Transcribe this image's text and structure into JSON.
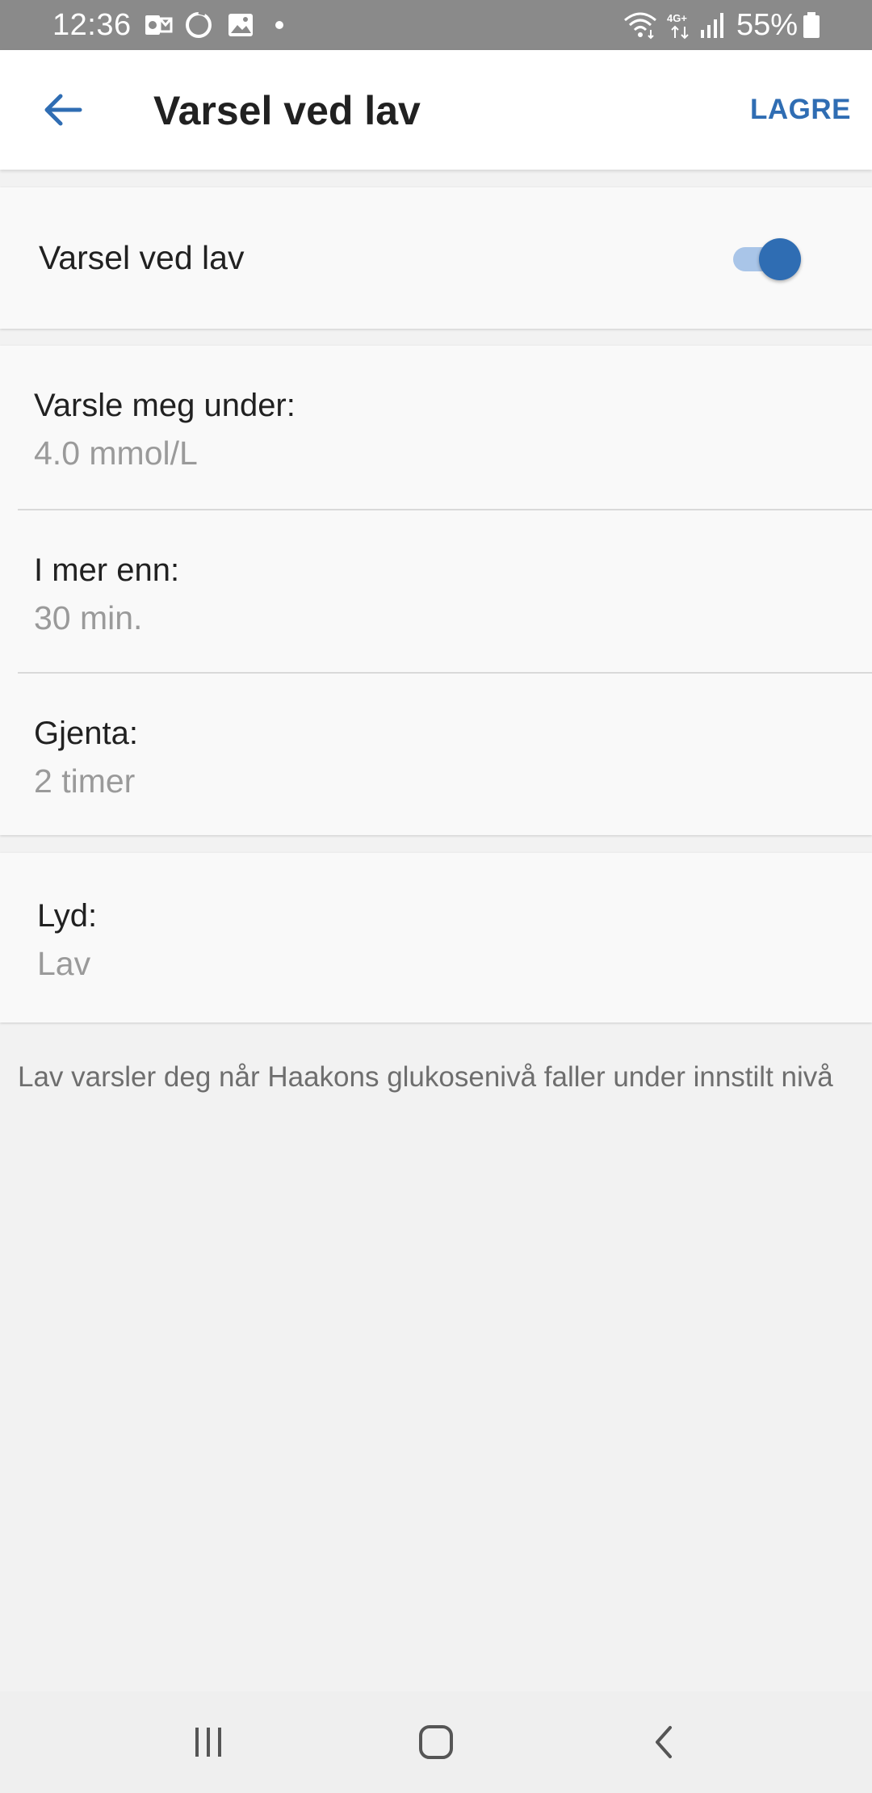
{
  "status_bar": {
    "time": "12:36",
    "battery": "55%",
    "icons": [
      "outlook-icon",
      "sync-circle-icon",
      "gallery-icon",
      "notification-dot-icon",
      "wifi-icon",
      "4g-icon",
      "signal-icon",
      "battery-icon"
    ],
    "network_label": "4G+"
  },
  "app_bar": {
    "back_icon": "arrow-left-icon",
    "title": "Varsel ved lav",
    "save_label": "LAGRE"
  },
  "alert_toggle": {
    "label": "Varsel ved lav",
    "enabled": true
  },
  "settings": [
    {
      "label": "Varsle meg under:",
      "value": "4.0 mmol/L"
    },
    {
      "label": "I mer enn:",
      "value": "30 min."
    },
    {
      "label": "Gjenta:",
      "value": "2 timer"
    }
  ],
  "sound": {
    "label": "Lyd:",
    "value": "Lav"
  },
  "footnote": "Lav varsler deg når Haakons glukosenivå faller under innstilt nivå",
  "nav_bar": {
    "icons": [
      "recent-apps-icon",
      "home-icon",
      "back-icon"
    ]
  },
  "colors": {
    "accent": "#2f6db3",
    "toggle_track": "#a9c5e8",
    "status_bar": "#8a8a8a",
    "background": "#f2f2f2",
    "secondary_text": "#9a9a9a"
  }
}
